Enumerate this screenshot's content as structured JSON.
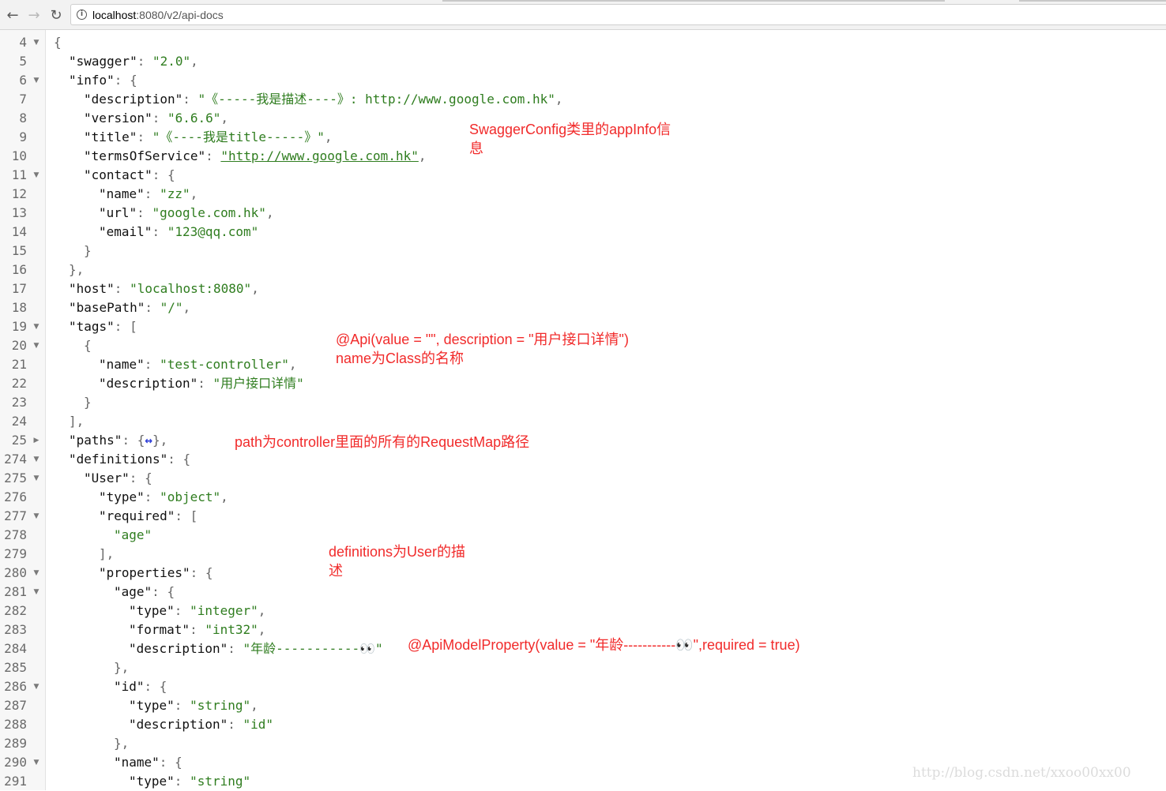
{
  "browser": {
    "url_host": "localhost",
    "url_rest": ":8080/v2/api-docs",
    "back_icon": "←",
    "forward_icon": "→",
    "reload_icon": "↻",
    "info_icon": "i"
  },
  "gutter": [
    {
      "n": "4",
      "fold": "open"
    },
    {
      "n": "5",
      "fold": ""
    },
    {
      "n": "6",
      "fold": "open"
    },
    {
      "n": "7",
      "fold": ""
    },
    {
      "n": "8",
      "fold": ""
    },
    {
      "n": "9",
      "fold": ""
    },
    {
      "n": "10",
      "fold": ""
    },
    {
      "n": "11",
      "fold": "open"
    },
    {
      "n": "12",
      "fold": ""
    },
    {
      "n": "13",
      "fold": ""
    },
    {
      "n": "14",
      "fold": ""
    },
    {
      "n": "15",
      "fold": ""
    },
    {
      "n": "16",
      "fold": ""
    },
    {
      "n": "17",
      "fold": ""
    },
    {
      "n": "18",
      "fold": ""
    },
    {
      "n": "19",
      "fold": "open"
    },
    {
      "n": "20",
      "fold": "open"
    },
    {
      "n": "21",
      "fold": ""
    },
    {
      "n": "22",
      "fold": ""
    },
    {
      "n": "23",
      "fold": ""
    },
    {
      "n": "24",
      "fold": ""
    },
    {
      "n": "25",
      "fold": "closed"
    },
    {
      "n": "274",
      "fold": "open"
    },
    {
      "n": "275",
      "fold": "open"
    },
    {
      "n": "276",
      "fold": ""
    },
    {
      "n": "277",
      "fold": "open"
    },
    {
      "n": "278",
      "fold": ""
    },
    {
      "n": "279",
      "fold": ""
    },
    {
      "n": "280",
      "fold": "open"
    },
    {
      "n": "281",
      "fold": "open"
    },
    {
      "n": "282",
      "fold": ""
    },
    {
      "n": "283",
      "fold": ""
    },
    {
      "n": "284",
      "fold": ""
    },
    {
      "n": "285",
      "fold": ""
    },
    {
      "n": "286",
      "fold": "open"
    },
    {
      "n": "287",
      "fold": ""
    },
    {
      "n": "288",
      "fold": ""
    },
    {
      "n": "289",
      "fold": ""
    },
    {
      "n": "290",
      "fold": "open"
    },
    {
      "n": "291",
      "fold": ""
    }
  ],
  "code_lines": [
    {
      "indent": 0,
      "tokens": [
        {
          "t": "p",
          "v": "{"
        }
      ]
    },
    {
      "indent": 1,
      "tokens": [
        {
          "t": "k",
          "v": "\"swagger\""
        },
        {
          "t": "p",
          "v": ": "
        },
        {
          "t": "s",
          "v": "\"2.0\""
        },
        {
          "t": "p",
          "v": ","
        }
      ]
    },
    {
      "indent": 1,
      "tokens": [
        {
          "t": "k",
          "v": "\"info\""
        },
        {
          "t": "p",
          "v": ": {"
        }
      ]
    },
    {
      "indent": 2,
      "tokens": [
        {
          "t": "k",
          "v": "\"description\""
        },
        {
          "t": "p",
          "v": ": "
        },
        {
          "t": "s",
          "v": "\"《-----我是描述----》: http://www.google.com.hk\""
        },
        {
          "t": "p",
          "v": ","
        }
      ]
    },
    {
      "indent": 2,
      "tokens": [
        {
          "t": "k",
          "v": "\"version\""
        },
        {
          "t": "p",
          "v": ": "
        },
        {
          "t": "s",
          "v": "\"6.6.6\""
        },
        {
          "t": "p",
          "v": ","
        }
      ]
    },
    {
      "indent": 2,
      "tokens": [
        {
          "t": "k",
          "v": "\"title\""
        },
        {
          "t": "p",
          "v": ": "
        },
        {
          "t": "s",
          "v": "\"《----我是title-----》\""
        },
        {
          "t": "p",
          "v": ","
        }
      ]
    },
    {
      "indent": 2,
      "tokens": [
        {
          "t": "k",
          "v": "\"termsOfService\""
        },
        {
          "t": "p",
          "v": ": "
        },
        {
          "t": "lnk",
          "v": "\"http://www.google.com.hk\""
        },
        {
          "t": "p",
          "v": ","
        }
      ]
    },
    {
      "indent": 2,
      "tokens": [
        {
          "t": "k",
          "v": "\"contact\""
        },
        {
          "t": "p",
          "v": ": {"
        }
      ]
    },
    {
      "indent": 3,
      "tokens": [
        {
          "t": "k",
          "v": "\"name\""
        },
        {
          "t": "p",
          "v": ": "
        },
        {
          "t": "s",
          "v": "\"zz\""
        },
        {
          "t": "p",
          "v": ","
        }
      ]
    },
    {
      "indent": 3,
      "tokens": [
        {
          "t": "k",
          "v": "\"url\""
        },
        {
          "t": "p",
          "v": ": "
        },
        {
          "t": "s",
          "v": "\"google.com.hk\""
        },
        {
          "t": "p",
          "v": ","
        }
      ]
    },
    {
      "indent": 3,
      "tokens": [
        {
          "t": "k",
          "v": "\"email\""
        },
        {
          "t": "p",
          "v": ": "
        },
        {
          "t": "s",
          "v": "\"123@qq.com\""
        }
      ]
    },
    {
      "indent": 2,
      "tokens": [
        {
          "t": "p",
          "v": "}"
        }
      ]
    },
    {
      "indent": 1,
      "tokens": [
        {
          "t": "p",
          "v": "},"
        }
      ]
    },
    {
      "indent": 1,
      "tokens": [
        {
          "t": "k",
          "v": "\"host\""
        },
        {
          "t": "p",
          "v": ": "
        },
        {
          "t": "s",
          "v": "\"localhost:8080\""
        },
        {
          "t": "p",
          "v": ","
        }
      ]
    },
    {
      "indent": 1,
      "tokens": [
        {
          "t": "k",
          "v": "\"basePath\""
        },
        {
          "t": "p",
          "v": ": "
        },
        {
          "t": "s",
          "v": "\"/\""
        },
        {
          "t": "p",
          "v": ","
        }
      ]
    },
    {
      "indent": 1,
      "tokens": [
        {
          "t": "k",
          "v": "\"tags\""
        },
        {
          "t": "p",
          "v": ": ["
        }
      ]
    },
    {
      "indent": 2,
      "tokens": [
        {
          "t": "p",
          "v": "{"
        }
      ]
    },
    {
      "indent": 3,
      "tokens": [
        {
          "t": "k",
          "v": "\"name\""
        },
        {
          "t": "p",
          "v": ": "
        },
        {
          "t": "s",
          "v": "\"test-controller\""
        },
        {
          "t": "p",
          "v": ","
        }
      ]
    },
    {
      "indent": 3,
      "tokens": [
        {
          "t": "k",
          "v": "\"description\""
        },
        {
          "t": "p",
          "v": ": "
        },
        {
          "t": "s",
          "v": "\"用户接口详情\""
        }
      ]
    },
    {
      "indent": 2,
      "tokens": [
        {
          "t": "p",
          "v": "}"
        }
      ]
    },
    {
      "indent": 1,
      "tokens": [
        {
          "t": "p",
          "v": "],"
        }
      ]
    },
    {
      "indent": 1,
      "tokens": [
        {
          "t": "k",
          "v": "\"paths\""
        },
        {
          "t": "p",
          "v": ": {"
        },
        {
          "t": "collapsed",
          "v": "↔"
        },
        {
          "t": "p",
          "v": "},"
        }
      ]
    },
    {
      "indent": 1,
      "tokens": [
        {
          "t": "k",
          "v": "\"definitions\""
        },
        {
          "t": "p",
          "v": ": {"
        }
      ]
    },
    {
      "indent": 2,
      "tokens": [
        {
          "t": "k",
          "v": "\"User\""
        },
        {
          "t": "p",
          "v": ": {"
        }
      ]
    },
    {
      "indent": 3,
      "tokens": [
        {
          "t": "k",
          "v": "\"type\""
        },
        {
          "t": "p",
          "v": ": "
        },
        {
          "t": "s",
          "v": "\"object\""
        },
        {
          "t": "p",
          "v": ","
        }
      ]
    },
    {
      "indent": 3,
      "tokens": [
        {
          "t": "k",
          "v": "\"required\""
        },
        {
          "t": "p",
          "v": ": ["
        }
      ]
    },
    {
      "indent": 4,
      "tokens": [
        {
          "t": "s",
          "v": "\"age\""
        }
      ]
    },
    {
      "indent": 3,
      "tokens": [
        {
          "t": "p",
          "v": "],"
        }
      ]
    },
    {
      "indent": 3,
      "tokens": [
        {
          "t": "k",
          "v": "\"properties\""
        },
        {
          "t": "p",
          "v": ": {"
        }
      ]
    },
    {
      "indent": 4,
      "tokens": [
        {
          "t": "k",
          "v": "\"age\""
        },
        {
          "t": "p",
          "v": ": {"
        }
      ]
    },
    {
      "indent": 5,
      "tokens": [
        {
          "t": "k",
          "v": "\"type\""
        },
        {
          "t": "p",
          "v": ": "
        },
        {
          "t": "s",
          "v": "\"integer\""
        },
        {
          "t": "p",
          "v": ","
        }
      ]
    },
    {
      "indent": 5,
      "tokens": [
        {
          "t": "k",
          "v": "\"format\""
        },
        {
          "t": "p",
          "v": ": "
        },
        {
          "t": "s",
          "v": "\"int32\""
        },
        {
          "t": "p",
          "v": ","
        }
      ]
    },
    {
      "indent": 5,
      "tokens": [
        {
          "t": "k",
          "v": "\"description\""
        },
        {
          "t": "p",
          "v": ": "
        },
        {
          "t": "s",
          "v": "\"年龄-----------👀\""
        }
      ]
    },
    {
      "indent": 4,
      "tokens": [
        {
          "t": "p",
          "v": "},"
        }
      ]
    },
    {
      "indent": 4,
      "tokens": [
        {
          "t": "k",
          "v": "\"id\""
        },
        {
          "t": "p",
          "v": ": {"
        }
      ]
    },
    {
      "indent": 5,
      "tokens": [
        {
          "t": "k",
          "v": "\"type\""
        },
        {
          "t": "p",
          "v": ": "
        },
        {
          "t": "s",
          "v": "\"string\""
        },
        {
          "t": "p",
          "v": ","
        }
      ]
    },
    {
      "indent": 5,
      "tokens": [
        {
          "t": "k",
          "v": "\"description\""
        },
        {
          "t": "p",
          "v": ": "
        },
        {
          "t": "s",
          "v": "\"id\""
        }
      ]
    },
    {
      "indent": 4,
      "tokens": [
        {
          "t": "p",
          "v": "},"
        }
      ]
    },
    {
      "indent": 4,
      "tokens": [
        {
          "t": "k",
          "v": "\"name\""
        },
        {
          "t": "p",
          "v": ": {"
        }
      ]
    },
    {
      "indent": 5,
      "tokens": [
        {
          "t": "k",
          "v": "\"type\""
        },
        {
          "t": "p",
          "v": ": "
        },
        {
          "t": "s",
          "v": "\"string\""
        }
      ]
    }
  ],
  "annotations": {
    "app_info": "SwaggerConfig类里的appInfo信\n息",
    "api": "@Api(value = \"\", description = \"用户接口详情\")\nname为Class的名称",
    "paths": "path为controller里面的所有的RequestMap路径",
    "definitions": "definitions为User的描\n述",
    "model_property": "@ApiModelProperty(value = \"年龄-----------👀\",required = true)"
  },
  "watermark": "http://blog.csdn.net/xxoo00xx00"
}
